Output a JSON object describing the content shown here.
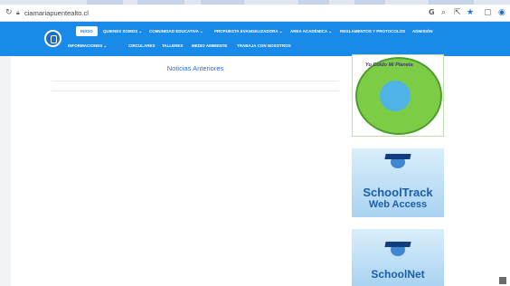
{
  "browser": {
    "url": "ciamariapuentealto.cl",
    "icons": [
      "reload-icon",
      "lock-icon",
      "google-icon",
      "zoom-icon",
      "share-icon",
      "bookmark-star-icon",
      "sidebar-icon",
      "profile-icon"
    ]
  },
  "nav": {
    "row1": [
      "INICIO",
      "QUIENES SOMOS ⌄",
      "COMUNIDAD EDUCATIVA ⌄",
      "PROPUESTA EVANGELIZADORA ⌄",
      "AREA ACADÉMICA ⌄",
      "REGLAMENTOS Y PROTOCOLOS",
      "ADMISIÓN"
    ],
    "row2": [
      "INFORMACIONES ⌄",
      "CIRCULARES",
      "TALLERES",
      "MEDIO AMBIENTE",
      "TRABAJA CON NOSOTROS"
    ]
  },
  "main": {
    "heading": "Noticias Anteriores"
  },
  "sidebar": {
    "banner1_text": "Yo Cuido Mi Planeta",
    "banner2_line1": "SchoolTrack",
    "banner2_line2": "Web Access",
    "banner3_text": "SchoolNet"
  },
  "colors": {
    "nav_bg": "#1a8ae8",
    "heading": "#2c6fd6",
    "banner_text": "#1b5fa8"
  }
}
